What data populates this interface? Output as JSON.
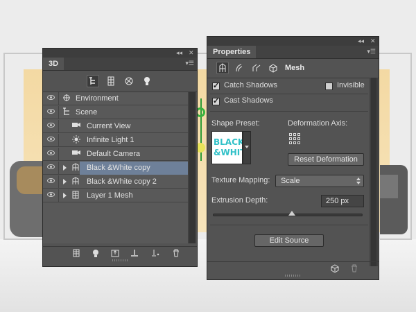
{
  "panel_3d": {
    "tab_label": "3D",
    "collapse_glyph": "◂◂",
    "close_glyph": "✕",
    "menu_glyph": "▾☰",
    "toolbar_icons": [
      "scene-filter-icon",
      "mesh-filter-icon",
      "material-filter-icon",
      "light-filter-icon"
    ],
    "layers": [
      {
        "label": "Environment",
        "icon": "environment-icon",
        "selected": false,
        "expandable": false
      },
      {
        "label": "Scene",
        "icon": "scene-icon",
        "selected": false,
        "expandable": false
      },
      {
        "label": "Current View",
        "icon": "camera-icon",
        "selected": false,
        "expandable": false
      },
      {
        "label": "Infinite Light 1",
        "icon": "light-icon",
        "selected": false,
        "expandable": false
      },
      {
        "label": "Default Camera",
        "icon": "camera-icon",
        "selected": false,
        "expandable": false
      },
      {
        "label": "Black &White copy",
        "icon": "mesh-icon",
        "selected": true,
        "expandable": true
      },
      {
        "label": "Black &White copy 2",
        "icon": "mesh-icon",
        "selected": false,
        "expandable": true
      },
      {
        "label": "Layer 1 Mesh",
        "icon": "layer-mesh-icon",
        "selected": false,
        "expandable": true
      }
    ],
    "bottom_icons": [
      "render-icon",
      "add-light-icon",
      "new-object-icon",
      "drop-to-plane-icon",
      "filter-options-icon",
      "delete-icon"
    ]
  },
  "properties": {
    "tab_label": "Properties",
    "collapse_glyph": "◂◂",
    "close_glyph": "✕",
    "menu_glyph": "▾☰",
    "mode_label": "Mesh",
    "catch_shadows_label": "Catch Shadows",
    "catch_shadows_checked": true,
    "invisible_label": "Invisible",
    "invisible_checked": false,
    "cast_shadows_label": "Cast Shadows",
    "cast_shadows_checked": true,
    "shape_preset_label": "Shape Preset:",
    "preset_line1": "BLACK",
    "preset_line2": "&WHITE",
    "deformation_axis_label": "Deformation Axis:",
    "reset_deformation_label": "Reset Deformation",
    "texture_mapping_label": "Texture Mapping:",
    "texture_mapping_value": "Scale",
    "extrusion_depth_label": "Extrusion Depth:",
    "extrusion_depth_value": "250 px",
    "edit_source_label": "Edit Source",
    "check_glyph": "✓"
  },
  "colors": {
    "panel_bg": "#535353",
    "selected_row": "#6e8099",
    "preset_text": "#31c1c8"
  }
}
